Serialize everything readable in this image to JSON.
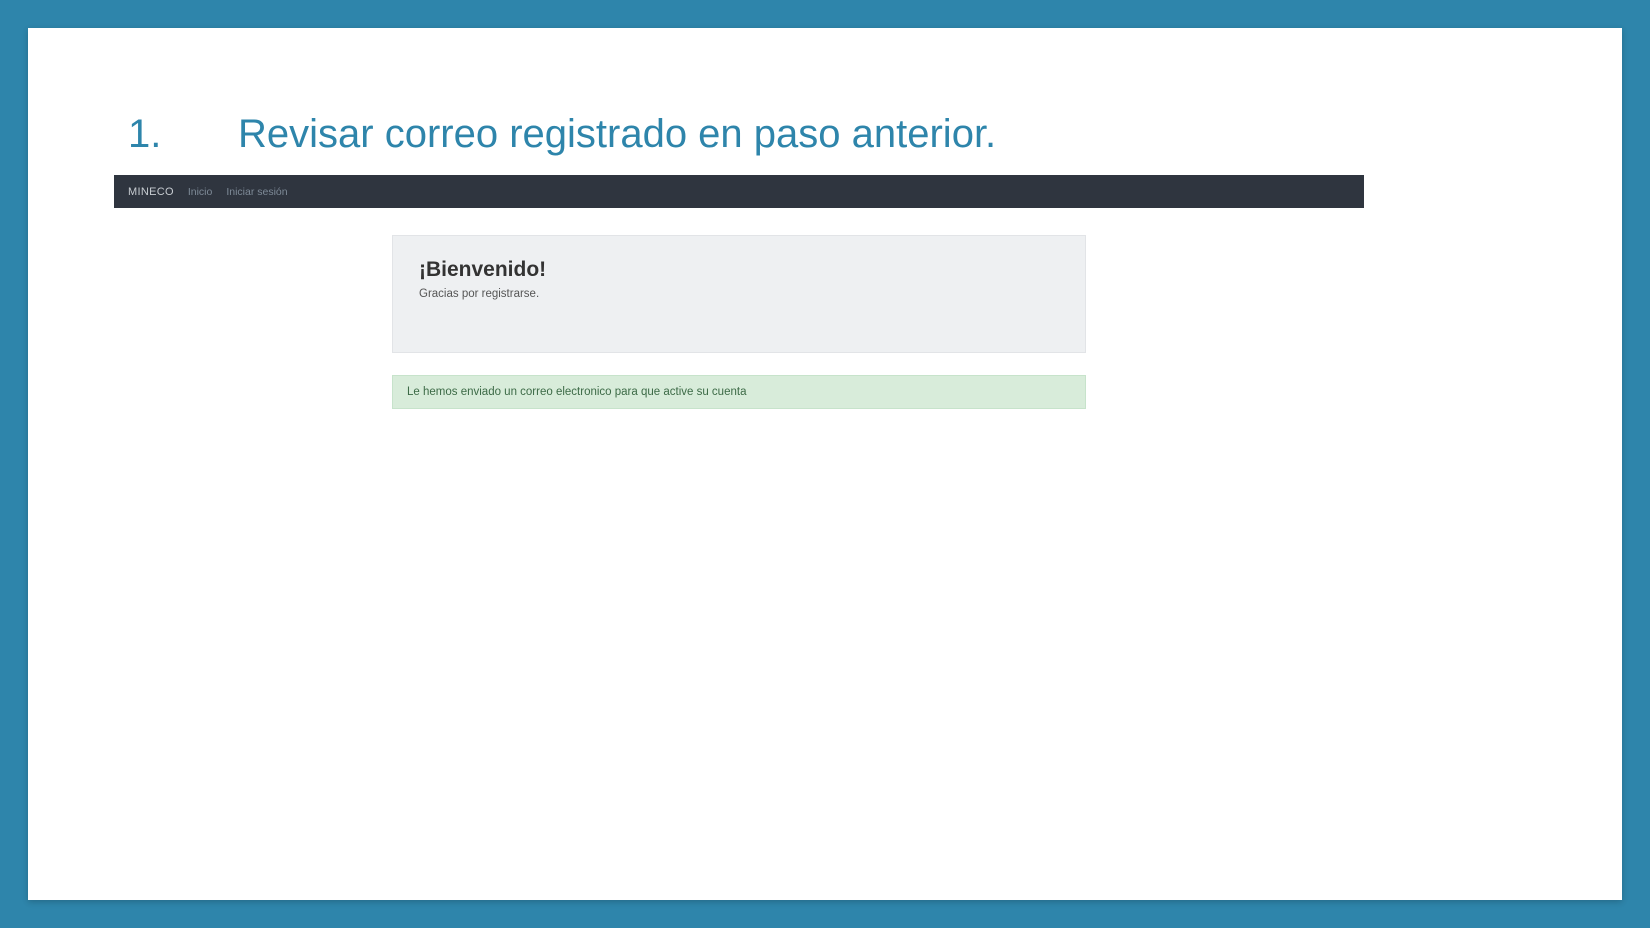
{
  "slide": {
    "number": "1.",
    "heading": "Revisar correo registrado en paso anterior."
  },
  "navbar": {
    "brand": "MINECO",
    "links": [
      "Inicio",
      "Iniciar sesión"
    ]
  },
  "welcome": {
    "title": "¡Bienvenido!",
    "subtitle": "Gracias por registrarse."
  },
  "alert": {
    "message": "Le hemos enviado un correo electronico para que active su cuenta"
  }
}
